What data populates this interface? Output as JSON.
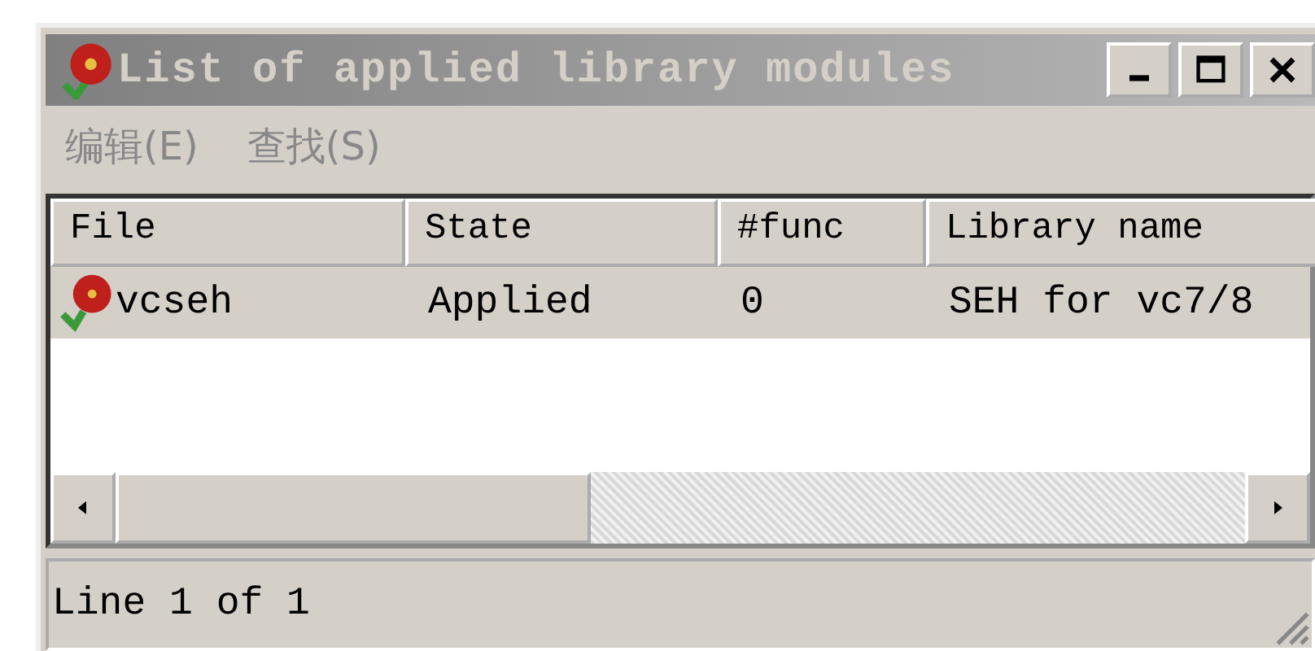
{
  "window": {
    "title": "List of applied library modules",
    "active": false
  },
  "menu": [
    {
      "label": "编辑(E)"
    },
    {
      "label": "查找(S)"
    }
  ],
  "table": {
    "columns": [
      "File",
      "State",
      "#func",
      "Library name"
    ],
    "rows": [
      {
        "cells": [
          "vcseh",
          "Applied",
          "0",
          "SEH for vc7/8"
        ],
        "selected": true
      }
    ]
  },
  "status_bar": "Line 1 of 1"
}
